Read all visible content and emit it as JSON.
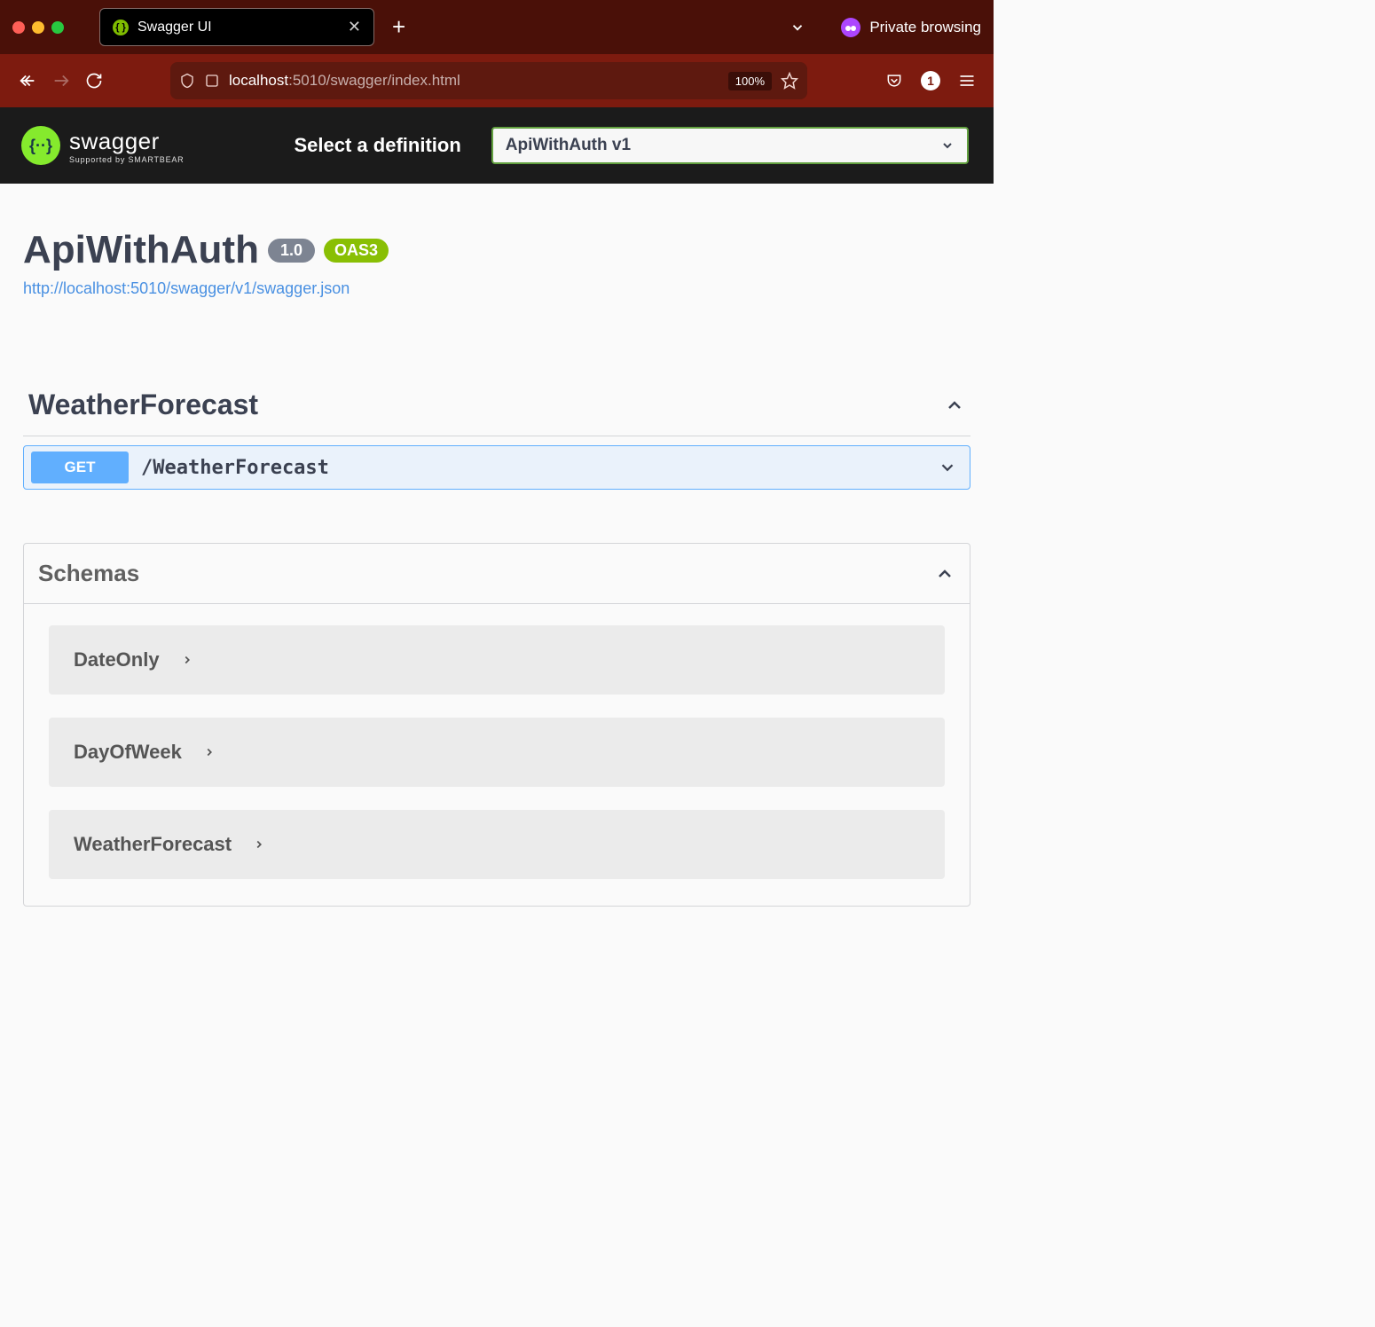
{
  "browser": {
    "tab_title": "Swagger UI",
    "private_label": "Private browsing",
    "url_host": "localhost",
    "url_path": ":5010/swagger/index.html",
    "zoom": "100%",
    "badge_count": "1"
  },
  "swagger_header": {
    "logo_main": "swagger",
    "logo_sub": "Supported by SMARTBEAR",
    "select_label": "Select a definition",
    "selected_def": "ApiWithAuth v1"
  },
  "info": {
    "title": "ApiWithAuth",
    "version": "1.0",
    "oas": "OAS3",
    "spec_url": "http://localhost:5010/swagger/v1/swagger.json"
  },
  "tags": [
    {
      "name": "WeatherForecast",
      "operations": [
        {
          "method": "GET",
          "path": "/WeatherForecast"
        }
      ]
    }
  ],
  "schemas_title": "Schemas",
  "schemas": [
    {
      "name": "DateOnly"
    },
    {
      "name": "DayOfWeek"
    },
    {
      "name": "WeatherForecast"
    }
  ]
}
